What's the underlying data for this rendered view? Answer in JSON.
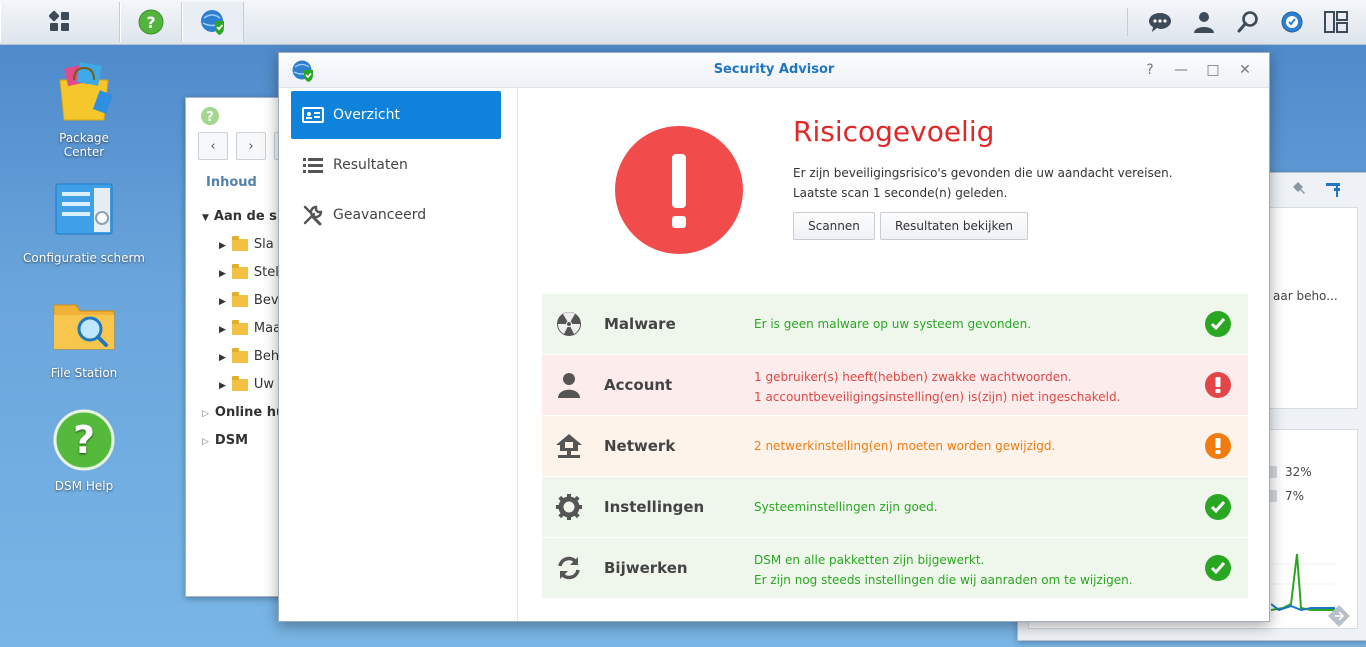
{
  "desktop": {
    "icons": [
      {
        "label_line1": "Package",
        "label_line2": "Center"
      },
      {
        "label": "Configuratie scherm"
      },
      {
        "label": "File Station"
      },
      {
        "label": "DSM Help"
      }
    ]
  },
  "bg_window": {
    "section": "Inhoud",
    "tree": [
      {
        "label": "Aan de sla",
        "expanded": true
      },
      {
        "label": "Sla b"
      },
      {
        "label": "Stel"
      },
      {
        "label": "Beve"
      },
      {
        "label": "Maa"
      },
      {
        "label": "Behe"
      },
      {
        "label": "Uw d"
      },
      {
        "label": "Online hu"
      },
      {
        "label": "DSM"
      }
    ]
  },
  "widget": {
    "partial_text": "aar beho...",
    "cpu_percent": "32%",
    "ram_percent": "7%"
  },
  "window": {
    "title": "Security Advisor",
    "help": "?",
    "minimize": "—",
    "maximize": "□",
    "close": "✕"
  },
  "sidebar": {
    "items": [
      {
        "label": "Overzicht",
        "active": true
      },
      {
        "label": "Resultaten"
      },
      {
        "label": "Geavanceerd"
      }
    ]
  },
  "status": {
    "title": "Risicogevoelig",
    "line1": "Er zijn beveiligingsrisico's gevonden die uw aandacht vereisen.",
    "line2": "Laatste scan 1 seconde(n) geleden.",
    "scan_button": "Scannen",
    "results_button": "Resultaten bekijken"
  },
  "categories": [
    {
      "name": "Malware",
      "msg1": "Er is geen malware op uw systeem gevonden.",
      "msg2": "",
      "state": "ok",
      "icon": "radiation-icon"
    },
    {
      "name": "Account",
      "msg1": "1 gebruiker(s) heeft(hebben) zwakke wachtwoorden.",
      "msg2": "1 accountbeveiligingsinstelling(en) is(zijn) niet ingeschakeld.",
      "state": "danger",
      "icon": "user-icon"
    },
    {
      "name": "Netwerk",
      "msg1": "2 netwerkinstelling(en) moeten worden gewijzigd.",
      "msg2": "",
      "state": "warning",
      "icon": "network-icon"
    },
    {
      "name": "Instellingen",
      "msg1": "Systeeminstellingen zijn goed.",
      "msg2": "",
      "state": "ok",
      "icon": "gear-icon"
    },
    {
      "name": "Bijwerken",
      "msg1": "DSM en alle pakketten zijn bijgewerkt.",
      "msg2": "Er zijn nog steeds instellingen die wij aanraden om te wijzigen.",
      "state": "ok",
      "icon": "refresh-icon"
    }
  ],
  "colors": {
    "accent": "#0f83db",
    "danger": "#e24646",
    "warning": "#f07c11",
    "ok": "#2aa722"
  }
}
